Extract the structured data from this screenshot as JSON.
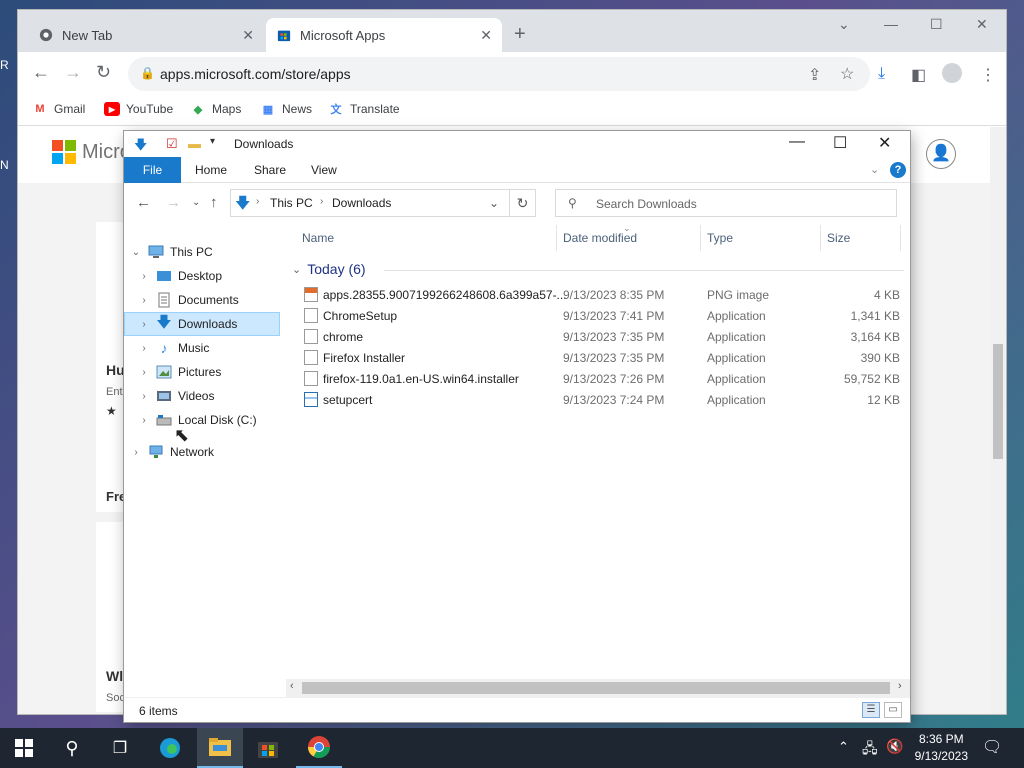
{
  "chrome": {
    "tabs": [
      {
        "title": "New Tab"
      },
      {
        "title": "Microsoft Apps"
      }
    ],
    "url": "apps.microsoft.com/store/apps",
    "bookmarks": [
      "Gmail",
      "YouTube",
      "Maps",
      "News",
      "Translate"
    ]
  },
  "webpage": {
    "logo_text": "Micro",
    "fragments": [
      "Hu",
      "Ente",
      "Fre",
      "Wl",
      "Soc"
    ]
  },
  "explorer": {
    "title": "Downloads",
    "ribbon_tabs": [
      "File",
      "Home",
      "Share",
      "View"
    ],
    "breadcrumb": [
      "This PC",
      "Downloads"
    ],
    "search_placeholder": "Search Downloads",
    "nav": {
      "this_pc": "This PC",
      "items": [
        "Desktop",
        "Documents",
        "Downloads",
        "Music",
        "Pictures",
        "Videos",
        "Local Disk (C:)"
      ],
      "network": "Network",
      "selected": "Downloads"
    },
    "columns": [
      "Name",
      "Date modified",
      "Type",
      "Size"
    ],
    "group": "Today (6)",
    "files": [
      {
        "name": "apps.28355.9007199266248608.6a399a57-...",
        "date": "9/13/2023 8:35 PM",
        "type": "PNG image",
        "size": "4 KB"
      },
      {
        "name": "ChromeSetup",
        "date": "9/13/2023 7:41 PM",
        "type": "Application",
        "size": "1,341 KB"
      },
      {
        "name": "chrome",
        "date": "9/13/2023 7:35 PM",
        "type": "Application",
        "size": "3,164 KB"
      },
      {
        "name": "Firefox Installer",
        "date": "9/13/2023 7:35 PM",
        "type": "Application",
        "size": "390 KB"
      },
      {
        "name": "firefox-119.0a1.en-US.win64.installer",
        "date": "9/13/2023 7:26 PM",
        "type": "Application",
        "size": "59,752 KB"
      },
      {
        "name": "setupcert",
        "date": "9/13/2023 7:24 PM",
        "type": "Application",
        "size": "12 KB"
      }
    ],
    "status": "6 items"
  },
  "taskbar": {
    "time": "8:36 PM",
    "date": "9/13/2023"
  },
  "colors": {
    "accent": "#1979ca",
    "selection": "#cce8ff",
    "taskbar": "#1e2731",
    "group_header": "#1e3287"
  }
}
